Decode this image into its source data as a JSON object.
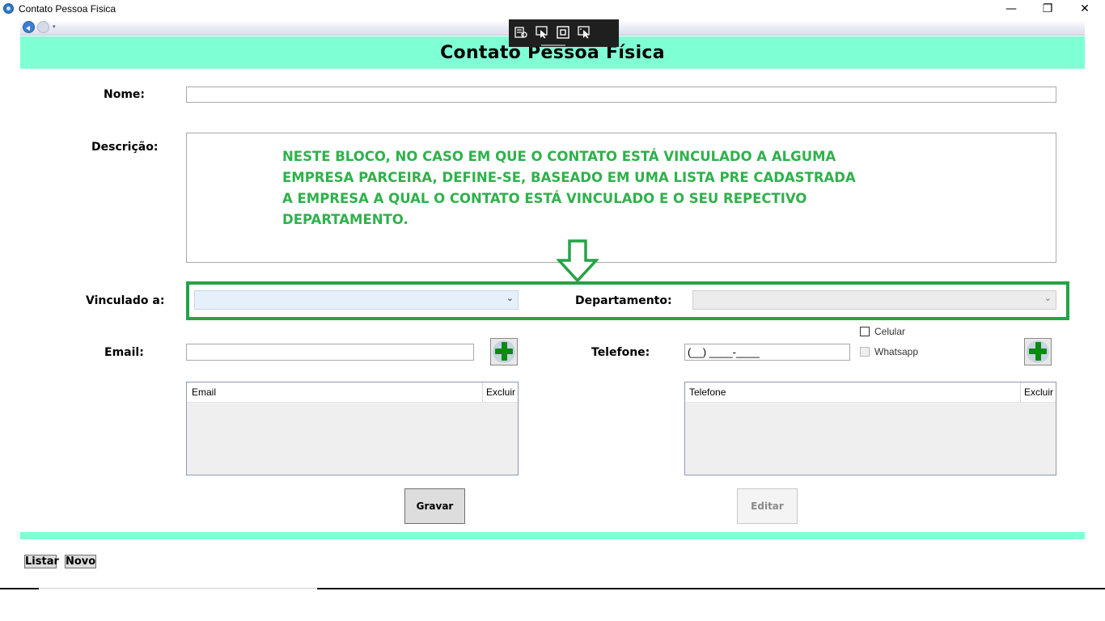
{
  "window": {
    "title": "Contato Pessoa Fisica",
    "minimize_glyph": "—",
    "restore_glyph": "❐",
    "close_glyph": "✕"
  },
  "nav": {
    "dropdown_glyph": "▾"
  },
  "header": {
    "title": "Contato Pessoa Física"
  },
  "form": {
    "nome_label": "Nome:",
    "nome_value": "",
    "descricao_label": "Descrição:",
    "descricao_annotation": "NESTE BLOCO, NO CASO EM QUE O CONTATO ESTÁ VINCULADO A ALGUMA EMPRESA PARCEIRA, DEFINE-SE, BASEADO EM UMA LISTA PRE CADASTRADA A EMPRESA A QUAL O CONTATO ESTÁ VINCULADO E O SEU REPECTIVO DEPARTAMENTO.",
    "vinculado_label": "Vinculado a:",
    "vinculado_value": "",
    "departamento_label": "Departamento:",
    "departamento_value": "",
    "combo_glyph": "⌄",
    "email_label": "Email:",
    "email_value": "",
    "telefone_label": "Telefone:",
    "telefone_mask": "(__) ____-____",
    "celular_label": "Celular",
    "celular_checked": false,
    "whatsapp_label": "Whatsapp",
    "whatsapp_checked": false
  },
  "email_grid": {
    "columns": [
      "Email",
      "Excluir"
    ],
    "rows": []
  },
  "telefone_grid": {
    "columns": [
      "Telefone",
      "Excluir"
    ],
    "rows": []
  },
  "buttons": {
    "gravar": "Gravar",
    "editar": "Editar",
    "listar": "Listar",
    "novo": "Novo"
  },
  "colors": {
    "header_band": "#7fffd4",
    "annotation": "#2fb14c",
    "highlight_border": "#25a346",
    "add_icon": "#0b8a12"
  }
}
